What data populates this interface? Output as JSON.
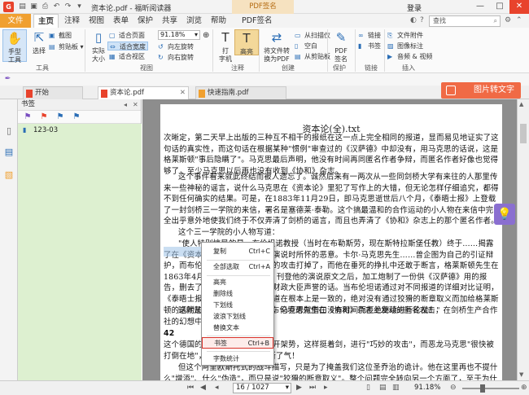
{
  "window": {
    "title": "资本论.pdf - 福昕阅读器",
    "pdf_sign_context": "PDF签名",
    "login": "登录",
    "minimize": "—",
    "maximize": "□",
    "close": "✕"
  },
  "menu_tabs": [
    "文件",
    "主页",
    "注释",
    "视图",
    "表单",
    "保护",
    "共享",
    "浏览",
    "帮助",
    "PDF签名"
  ],
  "active_tab": "主页",
  "search": {
    "placeholder": "查找",
    "mag": "⌕"
  },
  "ribbon": {
    "tools": {
      "hand": "手型\n工具",
      "select": "选择",
      "screenshot": "截图",
      "clipboard": "剪贴板",
      "label": "工具"
    },
    "view": {
      "actual_size": "实际\n大小",
      "fit_page": "适合页面",
      "fit_width": "适合宽度",
      "fit_visible": "适合视区",
      "zoom": "91.18%",
      "rotate_left": "向左旋转",
      "rotate_right": "向右旋转",
      "label": "视图"
    },
    "comment": {
      "typewriter": "打\n字机",
      "highlight": "高亮",
      "label": "注释"
    },
    "create": {
      "convert": "将文件转\n换为PDF",
      "from_scanner": "从扫描仪",
      "blank": "空白",
      "from_clipboard": "从剪贴板",
      "label": "创建"
    },
    "protect": {
      "pdf_sign": "PDF\n签名",
      "label": "保护"
    },
    "links": {
      "link": "链接",
      "bookmark": "书签",
      "label": "链接"
    },
    "insert": {
      "file_attachment": "文件附件",
      "image_annotation": "图像标注",
      "audio_video": "音频 & 视频",
      "label": "插入"
    }
  },
  "doc_tabs": [
    "开始",
    "资本论.pdf",
    "快速指南.pdf"
  ],
  "active_doc_tab": "资本论.pdf",
  "ocr_button": "图片转文字",
  "bookmark_panel": {
    "title": "书签",
    "items": [
      "123-03"
    ]
  },
  "document": {
    "title": "资本论(全).txt",
    "paragraphs": [
      "次晰定，第二天早上出版的三种互不相干的报纸在这一点上完全相同的报道，显而易见地证实了这句话的真实性，而这句话在根据某种\"惯例\"审查过的《汉萨德》中却没有，用马克思的话说，这是格莱斯顿\"事后隐瞒了\"。马克思最后声明，他没有时间再同匿名作者争辩，而匿名作者好像也觉得够了，至少马克思以后再也没有收到《协和》杂志。",
      "这个事件看来就此终结而被人遗忘了。诚然后来有一两次从一些同剑桥大学有来往的人那里传来一些神秘的谣言，说什么马克思在《资本论》里犯了写作上的大错，但无论怎样仔细追究，都得不到任何确实的结果。可是，在1883年11月29日，即马克思逝世后八个月，《泰晤士报》上登载了一封剑桥三一学院的来信，署名是塞德莱·泰勒。这个搞最温和的合作运动的小人物在来信中完全出乎意外地使我们终于不仅弄清了剑桥的谣言，而且也弄清了《协和》杂志上的那个匿名作者。",
      "这个三一学院的小人物写道：",
      "\"使人特别惊异的是，布伦坦诺教授（当时在布勒斯劳，现在斯特拉斯堡任教）终于……揭露了在《资本论》中引用格莱斯顿演说时所怀的恶意。卡尔·马克思先生……曾企图为自己的引证辩护，而布伦坦诺先生以非常巧妙的攻击打掉了，而他在垂死的挣扎中还敢于断言，格莱斯顿先生在1863年4月17日的《泰晤士报》刊登他的演说原文之后，加工炮制了一份供《汉萨德》用的报告，删去了一句确实有损他作为财政大臣声誉的话。当布伦坦诺通过对不同报道的详细对比证明，《泰晤士报》和《汉萨德》的报道在根本上是一致的，绝对没有通过狡猾的断章取义而加给格莱斯顿的话附加上的那种意思的时候，马克思就借口没有时间而拒绝继续进行论战！\"",
      "这就是事情的底细！这就是布伦坦诺先生在《协和》杂志上发动的匿名攻击，在剑桥生产合作社的幻想中是何等光辉的反映！",
      "42",
      "这个德国的圣乔治，就是这样摆开架势，这样挺着剑，进行\"巧妙的攻击\"，而恶龙马克思\"很快被打倒在地\"，\"在垂死的挣扎中\"断了气！",
      "但这个阿里欧斯托式的战斗描写，只是为了掩盖我们这位圣乔治的诡计。他在这里再也不提什么\"增添\"、什么\"伪造\"，而只是说\"狡猾的断章取义\"。整个问题完全转向另一个方面了，至于为什么要这样做，圣乔治和他的剑桥的卫士当然非常清楚。"
    ],
    "year": "1883",
    "month": "11",
    "day": "29"
  },
  "context_menu": {
    "items": [
      {
        "label": "复制",
        "shortcut": "Ctrl+C"
      },
      {
        "label": "全部选取",
        "shortcut": "Ctrl+A"
      },
      {
        "label": "高亮",
        "shortcut": ""
      },
      {
        "label": "删除线",
        "shortcut": ""
      },
      {
        "label": "下划线",
        "shortcut": ""
      },
      {
        "label": "波浪下划线",
        "shortcut": ""
      },
      {
        "label": "替换文本",
        "shortcut": ""
      },
      {
        "label": "书签",
        "shortcut": "Ctrl+B"
      },
      {
        "label": "字数统计",
        "shortcut": ""
      }
    ],
    "highlighted": "书签"
  },
  "statusbar": {
    "page": "16 / 1027",
    "zoom": "91.18%"
  },
  "colors": {
    "accent": "#f0a030",
    "ocr": "#f06a45",
    "bookmark_bg": "#ddf0d0",
    "selection": "#9fc3e8",
    "menu_highlight_border": "#d9322a"
  }
}
